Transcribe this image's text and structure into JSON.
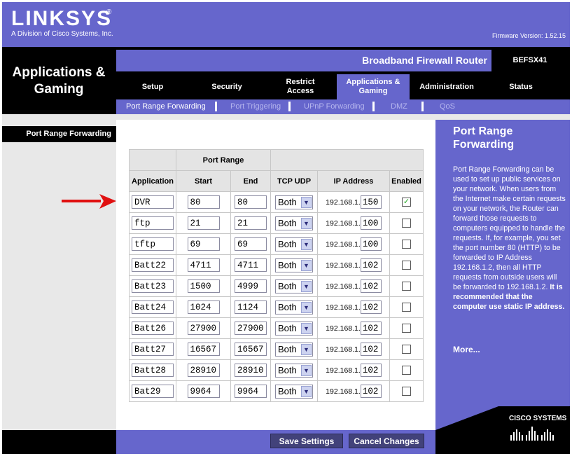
{
  "header": {
    "logo": "LINKSYS",
    "logo_reg": "®",
    "logo_subtitle": "A Division of Cisco Systems, Inc.",
    "firmware": "Firmware Version: 1.52.15"
  },
  "section_title": "Applications & Gaming",
  "product_name": "Broadband Firewall Router",
  "model": "BEFSX41",
  "tabs": [
    {
      "label": "Setup"
    },
    {
      "label": "Security"
    },
    {
      "label": "Restrict Access"
    },
    {
      "label": "Applications & Gaming"
    },
    {
      "label": "Administration"
    },
    {
      "label": "Status"
    }
  ],
  "subtabs": [
    {
      "label": "Port Range Forwarding"
    },
    {
      "label": "Port Triggering"
    },
    {
      "label": "UPnP Forwarding"
    },
    {
      "label": "DMZ"
    },
    {
      "label": "QoS"
    }
  ],
  "sidebar_label": "Port Range Forwarding",
  "table": {
    "group_header": "Port Range",
    "columns": [
      "Application",
      "Start",
      "End",
      "TCP UDP",
      "IP Address",
      "Enabled"
    ],
    "ip_prefix": "192.168.1.",
    "rows": [
      {
        "app": "DVR",
        "start": "80",
        "end": "80",
        "proto": "Both",
        "ip": "150",
        "enabled": "✓"
      },
      {
        "app": "ftp",
        "start": "21",
        "end": "21",
        "proto": "Both",
        "ip": "100",
        "enabled": ""
      },
      {
        "app": "tftp",
        "start": "69",
        "end": "69",
        "proto": "Both",
        "ip": "100",
        "enabled": ""
      },
      {
        "app": "Batt22",
        "start": "4711",
        "end": "4711",
        "proto": "Both",
        "ip": "102",
        "enabled": ""
      },
      {
        "app": "Batt23",
        "start": "1500",
        "end": "4999",
        "proto": "Both",
        "ip": "102",
        "enabled": ""
      },
      {
        "app": "Batt24",
        "start": "1024",
        "end": "1124",
        "proto": "Both",
        "ip": "102",
        "enabled": ""
      },
      {
        "app": "Batt26",
        "start": "27900",
        "end": "27900",
        "proto": "Both",
        "ip": "102",
        "enabled": ""
      },
      {
        "app": "Batt27",
        "start": "16567",
        "end": "16567",
        "proto": "Both",
        "ip": "102",
        "enabled": ""
      },
      {
        "app": "Batt28",
        "start": "28910",
        "end": "28910",
        "proto": "Both",
        "ip": "102",
        "enabled": ""
      },
      {
        "app": "Bat29",
        "start": "9964",
        "end": "9964",
        "proto": "Both",
        "ip": "102",
        "enabled": ""
      }
    ]
  },
  "help": {
    "title": "Port Range Forwarding",
    "body": "Port Range Forwarding can be used to set up public services on your network. When users from the Internet make certain requests on your network, the Router can forward those requests to computers equipped to handle the requests. If, for example, you set the port number 80 (HTTP) to be forwarded to IP Address 192.168.1.2, then all HTTP requests from outside users will be forwarded to 192.168.1.2.",
    "body_bold": "It is recommended that the computer use static IP address.",
    "more": "More..."
  },
  "buttons": {
    "save": "Save Settings",
    "cancel": "Cancel Changes"
  },
  "cisco": "CISCO SYSTEMS",
  "colors": {
    "brand_purple": "#6666cc",
    "arrow_red": "#e01010"
  }
}
